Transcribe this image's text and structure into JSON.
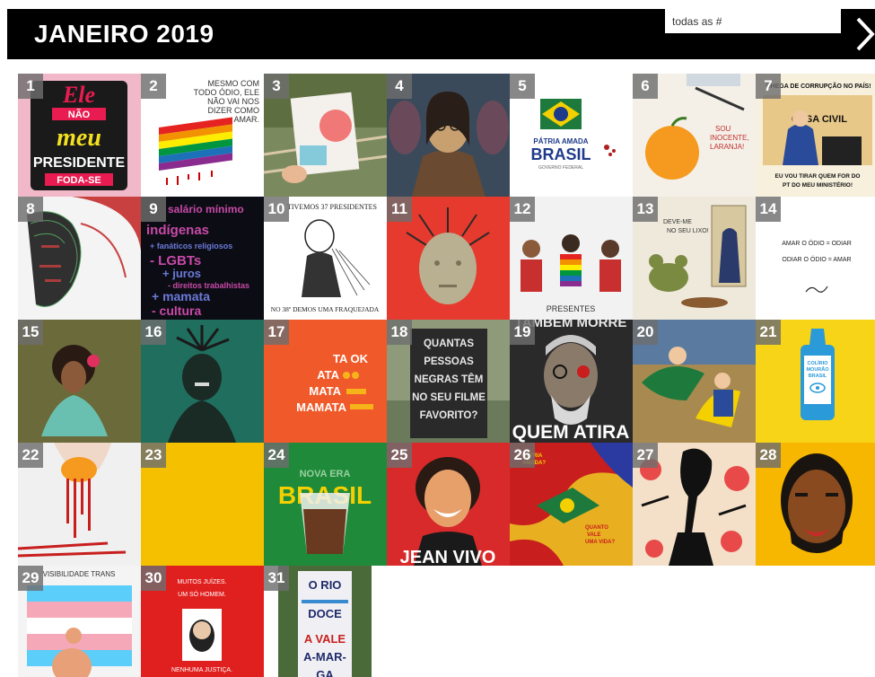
{
  "header": {
    "title": "JANEIRO 2019",
    "search_placeholder": "todas as #"
  },
  "calendar": {
    "days": [
      {
        "day": "1",
        "bg": "#f0b8c8"
      },
      {
        "day": "2",
        "bg": "#ffffff"
      },
      {
        "day": "3",
        "bg": "#7b8a5e"
      },
      {
        "day": "4",
        "bg": "#3a4a5a"
      },
      {
        "day": "5",
        "bg": "#ffffff"
      },
      {
        "day": "6",
        "bg": "#f4f0e8"
      },
      {
        "day": "7",
        "bg": "#f6f0dc"
      },
      {
        "day": "8",
        "bg": "#f4f4f4"
      },
      {
        "day": "9",
        "bg": "#0c0c14"
      },
      {
        "day": "10",
        "bg": "#ffffff"
      },
      {
        "day": "11",
        "bg": "#e63a2e"
      },
      {
        "day": "12",
        "bg": "#f2f2f2"
      },
      {
        "day": "13",
        "bg": "#efe9dc"
      },
      {
        "day": "14",
        "bg": "#ffffff"
      },
      {
        "day": "15",
        "bg": "#6b6a3a"
      },
      {
        "day": "16",
        "bg": "#1f6e5e"
      },
      {
        "day": "17",
        "bg": "#f05a2a"
      },
      {
        "day": "18",
        "bg": "#8e9a7a"
      },
      {
        "day": "19",
        "bg": "#2a2a2a"
      },
      {
        "day": "20",
        "bg": "#a88a50"
      },
      {
        "day": "21",
        "bg": "#f7d417"
      },
      {
        "day": "22",
        "bg": "#f0f0f0"
      },
      {
        "day": "23",
        "bg": "#f5c000"
      },
      {
        "day": "24",
        "bg": "#1e8a3a"
      },
      {
        "day": "25",
        "bg": "#d82a2a"
      },
      {
        "day": "26",
        "bg": "#e8b020"
      },
      {
        "day": "27",
        "bg": "#f4e0c8"
      },
      {
        "day": "28",
        "bg": "#f7b700"
      },
      {
        "day": "29",
        "bg": "#f4f4f4"
      },
      {
        "day": "30",
        "bg": "#e0201e"
      },
      {
        "day": "31",
        "bg": "#4a6a3a"
      }
    ],
    "art_text": {
      "t1_line1": "Ele",
      "t1_line2": "NÃO",
      "t1_line3": "meu",
      "t1_line4": "PRESIDENTE",
      "t1_line5": "FODA-SE",
      "t2_line1": "MESMO COM",
      "t2_line2": "TODO ÓDIO, ELE",
      "t2_line3": "NÃO VAI NOS",
      "t2_line4": "DIZER COMO",
      "t2_line5": "AMAR.",
      "t5_line1": "PÁTRIA AMADA",
      "t5_line2": "BRASIL",
      "t5_line3": "GOVERNO FEDERAL",
      "t6_line1": "SOU",
      "t6_line2": "INOCENTE,",
      "t6_line3": "LARANJA!",
      "t7_top": "CHEGA DE CORRUPÇÃO NO PAÍS!",
      "t7_mid": "CASA CIVIL",
      "t7_bot1": "EU VOU TIRAR QUEM FOR DO",
      "t7_bot2": "PT DO MEU MINISTÉRIO!",
      "t9_l1": "salário mínimo",
      "t9_l2": "indígenas",
      "t9_l3": "+ fanáticos religiosos",
      "t9_l4": "- LGBTs",
      "t9_l5": "+ juros",
      "t9_l6": "- direitos trabalhistas",
      "t9_l7": "+ mamata",
      "t9_l8": "- cultura",
      "t10_top": "TIVEMOS 37 PRESIDENTES",
      "t10_bot": "NO 38º DEMOS UMA FRAQUEJADA",
      "t12_bot": "PRESENTES",
      "t13_top": "DEVE-ME",
      "t13_top2": "NO SEU LIXO!",
      "t14_l1": "AMAR O ÓDIO = ODIAR",
      "t14_l2": "ODIAR O ÓDIO = AMAR",
      "t17_l1": "TA OK",
      "t17_l2": "ATA",
      "t17_l3": "MATA",
      "t17_l4": "MAMATA",
      "t18_l1": "QUANTAS",
      "t18_l2": "PESSOAS",
      "t18_l3": "NEGRAS TÊM",
      "t18_l4": "NO SEU FILME",
      "t18_l5": "FAVORITO?",
      "t19_top": "TAMBÉM MORRE",
      "t19_bot": "QUEM ATIRA",
      "t21_l1": "COLÍRIO",
      "t21_l2": "MOURÃO",
      "t21_l3": "BRASIL",
      "t24_l1": "NOVA ERA",
      "t24_l2": "BRASIL",
      "t25_bot": "JEAN VIVO",
      "t26_l1": "PÁTRIA",
      "t26_l2": "AMADA?",
      "t26_l3": "QUANTO",
      "t26_l4": "VALE",
      "t26_l5": "UMA VIDA?",
      "t29_top": "VISIBILIDADE TRANS",
      "t30_l1": "MUITOS JUÍZES.",
      "t30_l2": "UM SÓ HOMEM.",
      "t30_l3": "NENHUMA JUSTIÇA.",
      "t31_l1": "O RIO",
      "t31_l2": "DOCE",
      "t31_l3": "A VALE",
      "t31_l4": "A-MAR-",
      "t31_l5": "GA"
    }
  }
}
